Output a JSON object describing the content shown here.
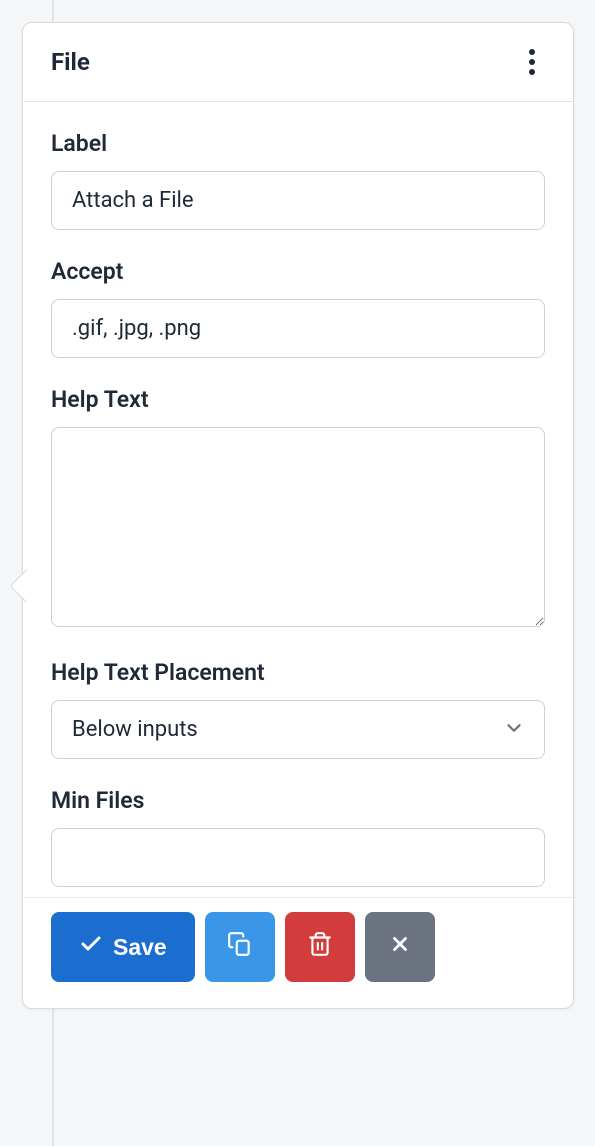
{
  "header": {
    "title": "File"
  },
  "fields": {
    "label": {
      "label": "Label",
      "value": "Attach a File"
    },
    "accept": {
      "label": "Accept",
      "value": ".gif, .jpg, .png"
    },
    "helpText": {
      "label": "Help Text",
      "value": ""
    },
    "helpTextPlacement": {
      "label": "Help Text Placement",
      "value": "Below inputs"
    },
    "minFiles": {
      "label": "Min Files",
      "value": ""
    }
  },
  "footer": {
    "save": "Save"
  }
}
